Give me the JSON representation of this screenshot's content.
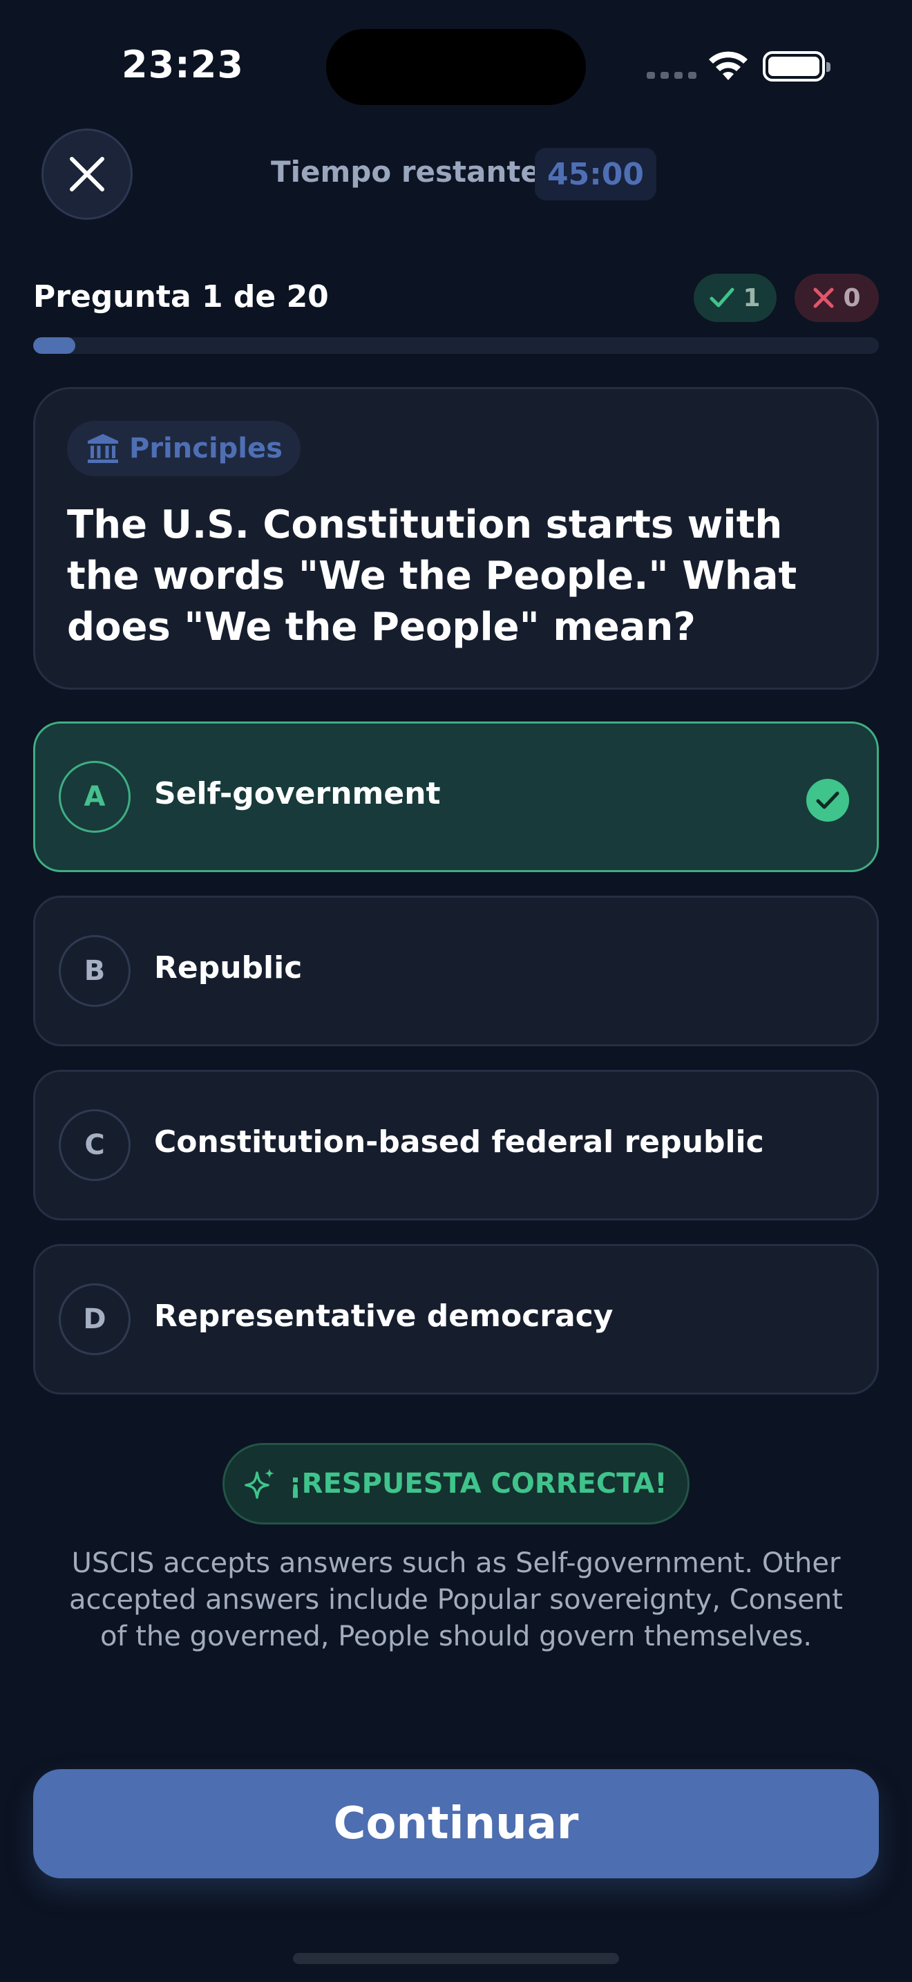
{
  "status_bar": {
    "time": "23:23"
  },
  "header": {
    "timer_label": "Tiempo restante",
    "timer_value": "45:00"
  },
  "progress": {
    "counter": "Pregunta 1 de 20",
    "correct_count": "1",
    "wrong_count": "0",
    "fraction": 0.05
  },
  "question": {
    "category": "Principles",
    "category_icon": "bank-columns-icon",
    "text": "The U.S. Constitution starts with the words \"We the People.\" What does \"We the People\" mean?"
  },
  "options": [
    {
      "letter": "A",
      "text": "Self-government",
      "state": "correct"
    },
    {
      "letter": "B",
      "text": "Republic",
      "state": "normal"
    },
    {
      "letter": "C",
      "text": "Constitution-based federal republic",
      "state": "normal"
    },
    {
      "letter": "D",
      "text": "Representative democracy",
      "state": "normal"
    }
  ],
  "feedback": {
    "title": "¡RESPUESTA CORRECTA!",
    "icon": "sparkles-icon",
    "explanation": "USCIS accepts answers such as Self-government. Other accepted answers include Popular sovereignty, Consent of the governed, People should govern themselves."
  },
  "continue_label": "Continuar",
  "colors": {
    "background": "#0c1322",
    "accent": "#4d6eb0",
    "correct": "#3fc48b",
    "wrong": "#e0566d"
  }
}
